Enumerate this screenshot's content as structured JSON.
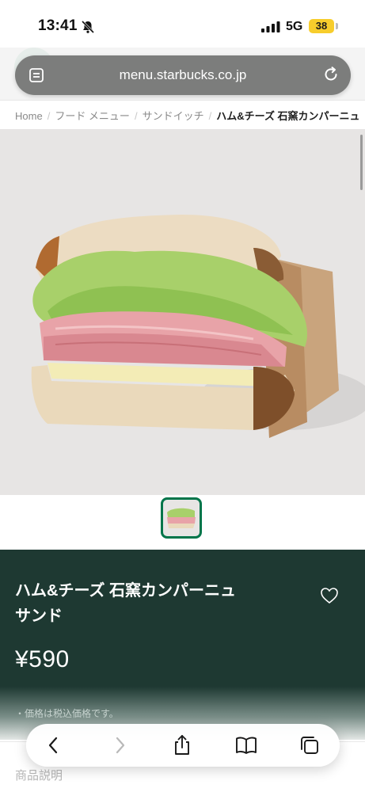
{
  "status_bar": {
    "time": "13:41",
    "network": "5G",
    "battery": "38"
  },
  "browser": {
    "url": "menu.starbucks.co.jp"
  },
  "breadcrumb": {
    "home": "Home",
    "food_menu": "フード メニュー",
    "sandwich": "サンドイッチ",
    "current": "ハム&チーズ 石窯カンパーニュ"
  },
  "product": {
    "name_line1": "ハム&チーズ 石窯カンパーニュ",
    "name_line2": "サンド",
    "price": "¥590",
    "tax_note": "・価格は税込価格です。"
  },
  "section": {
    "description_label": "商品説明"
  },
  "colors": {
    "brand_green": "#1e3932",
    "accent_green": "#00754a",
    "battery_yellow": "#f7cd2c"
  },
  "icons": [
    "bell-slash-icon",
    "signal-icon",
    "tabs-icon",
    "reload-icon",
    "heart-icon",
    "back-icon",
    "forward-icon",
    "share-icon",
    "bookmarks-icon",
    "tabs-overview-icon"
  ]
}
